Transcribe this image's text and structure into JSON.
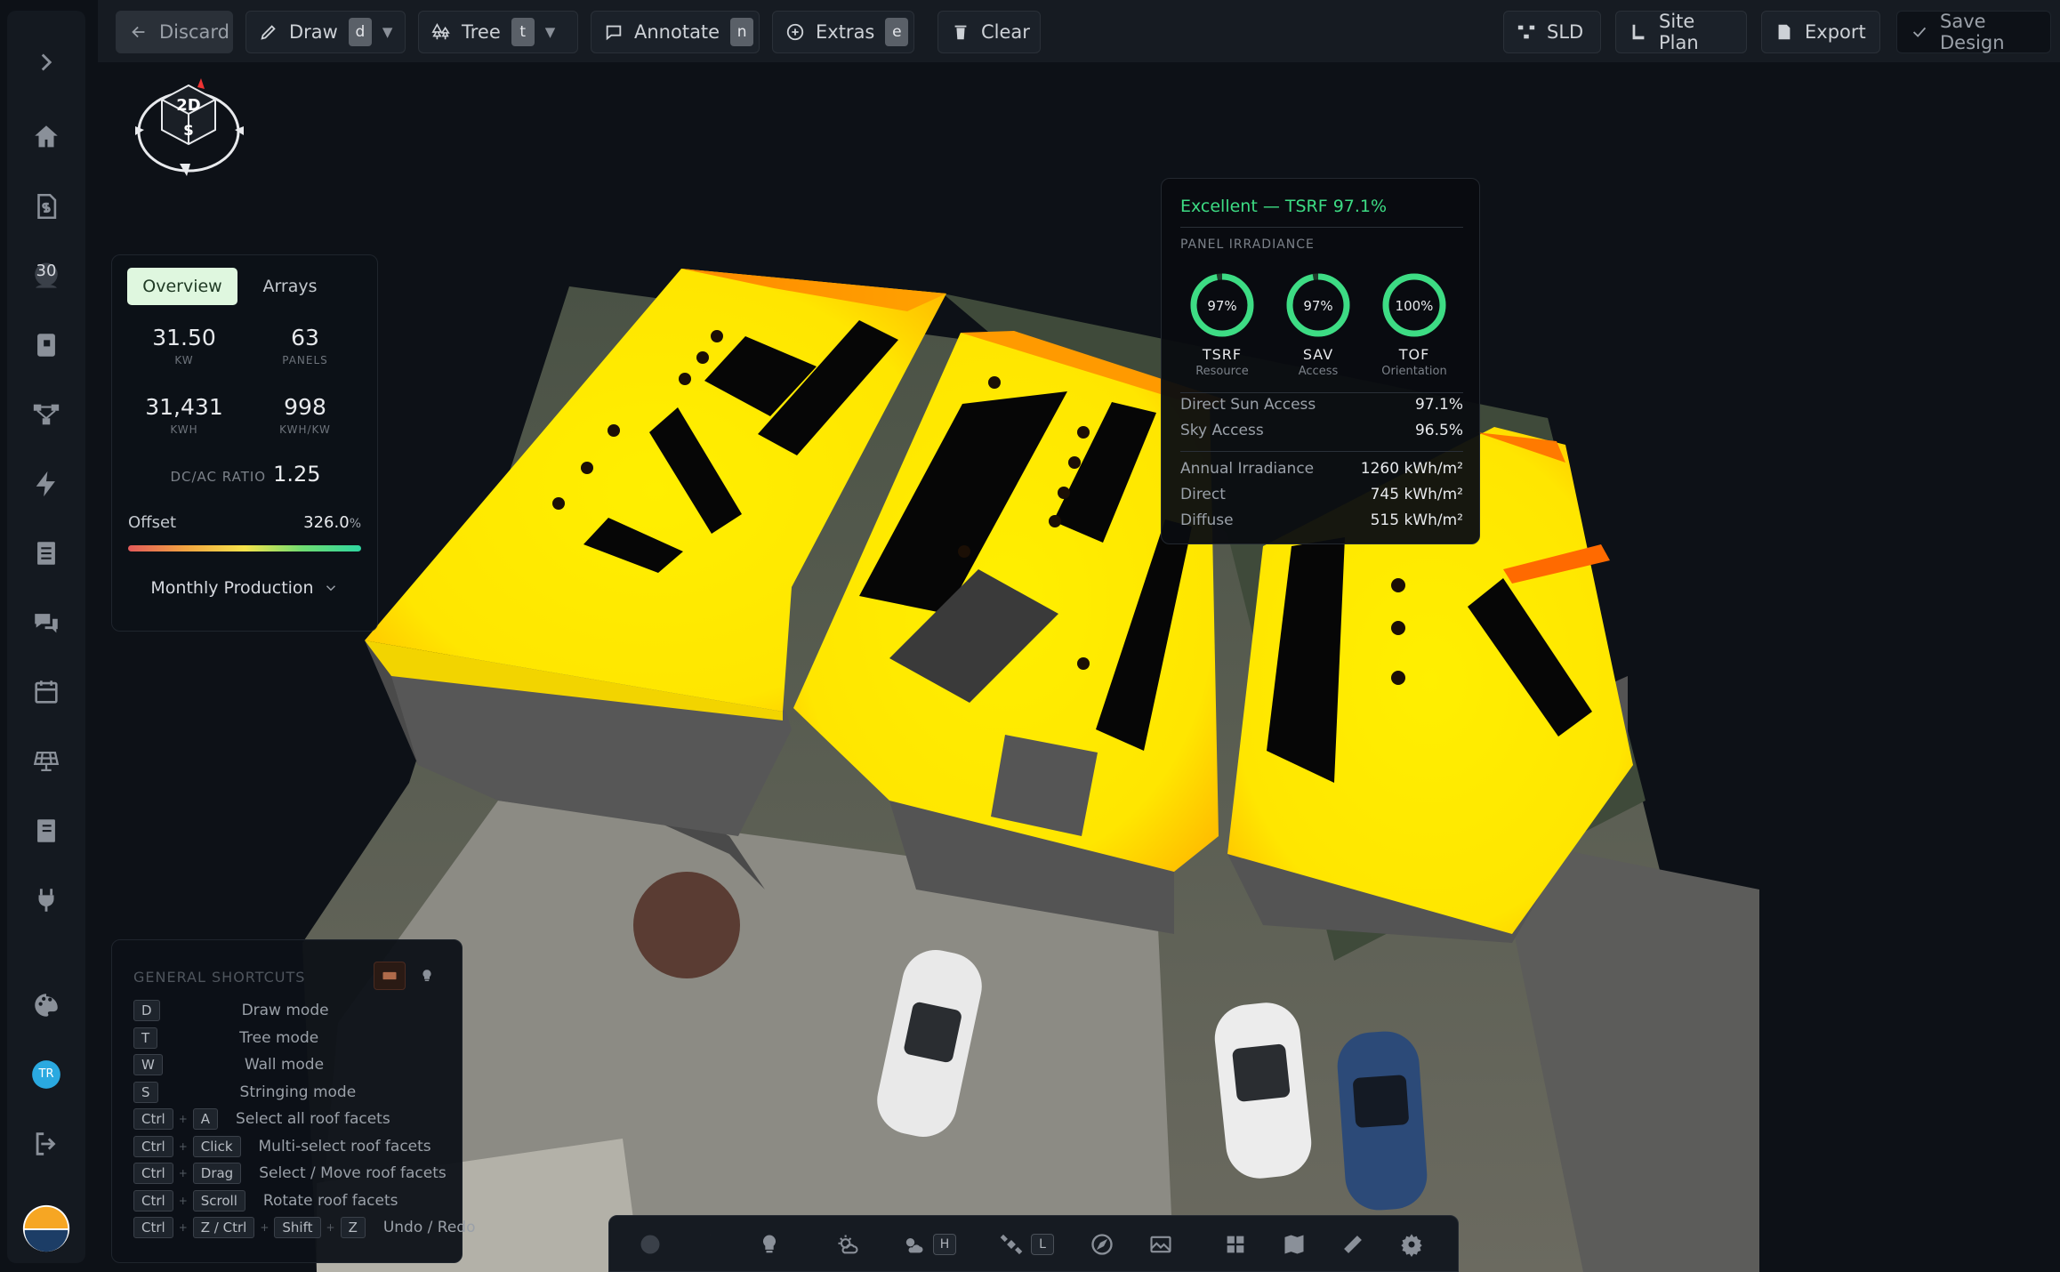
{
  "toolbar": {
    "discard": "Discard",
    "draw": "Draw",
    "draw_key": "d",
    "tree": "Tree",
    "tree_key": "t",
    "annotate": "Annotate",
    "annotate_key": "n",
    "extras": "Extras",
    "extras_key": "e",
    "clear": "Clear",
    "sld": "SLD",
    "site_plan": "Site Plan",
    "export": "Export",
    "save_design": "Save Design"
  },
  "sidebar": {
    "badge": "30",
    "avatar": "TR"
  },
  "view_cube": {
    "mode": "2D",
    "face": "S"
  },
  "overview": {
    "tabs": [
      "Overview",
      "Arrays"
    ],
    "stats": [
      {
        "value": "31.50",
        "unit": "KW"
      },
      {
        "value": "63",
        "unit": "PANELS"
      },
      {
        "value": "31,431",
        "unit": "KWH"
      },
      {
        "value": "998",
        "unit": "KWH/KW"
      }
    ],
    "ratio_label": "DC/AC RATIO",
    "ratio_value": "1.25",
    "offset_label": "Offset",
    "offset_value": "326.0",
    "offset_unit": "%",
    "monthly": "Monthly Production"
  },
  "irradiance": {
    "headline": "Excellent — TSRF 97.1%",
    "section": "PANEL IRRADIANCE",
    "rings": [
      {
        "value": "97%",
        "fraction": 0.97,
        "abbr": "TSRF",
        "desc": "Resource"
      },
      {
        "value": "97%",
        "fraction": 0.97,
        "abbr": "SAV",
        "desc": "Access"
      },
      {
        "value": "100%",
        "fraction": 1.0,
        "abbr": "TOF",
        "desc": "Orientation"
      }
    ],
    "rows": [
      {
        "label": "Direct Sun Access",
        "value": "97.1%"
      },
      {
        "label": "Sky Access",
        "value": "96.5%"
      },
      {
        "label": "Annual Irradiance",
        "value": "1260 kWh/m²"
      },
      {
        "label": "Direct",
        "value": "745 kWh/m²"
      },
      {
        "label": "Diffuse",
        "value": "515 kWh/m²"
      }
    ],
    "accent": "#3ddc84"
  },
  "shortcuts": {
    "title": "GENERAL SHORTCUTS",
    "rows": [
      {
        "keys": [
          "D"
        ],
        "label": "Draw mode"
      },
      {
        "keys": [
          "T"
        ],
        "label": "Tree mode"
      },
      {
        "keys": [
          "W"
        ],
        "label": "Wall mode"
      },
      {
        "keys": [
          "S"
        ],
        "label": "Stringing mode"
      },
      {
        "keys": [
          "Ctrl",
          "A"
        ],
        "label": "Select all roof facets"
      },
      {
        "keys": [
          "Ctrl",
          "Click"
        ],
        "label": "Multi-select roof facets"
      },
      {
        "keys": [
          "Ctrl",
          "Drag"
        ],
        "label": "Select / Move roof facets"
      },
      {
        "keys": [
          "Ctrl",
          "Scroll"
        ],
        "label": "Rotate roof facets"
      },
      {
        "keys": [
          "Ctrl",
          "Z / Ctrl",
          "Shift",
          "Z"
        ],
        "label": "Undo / Redo"
      }
    ]
  },
  "bottombar": {
    "key_h": "H",
    "key_l": "L"
  }
}
